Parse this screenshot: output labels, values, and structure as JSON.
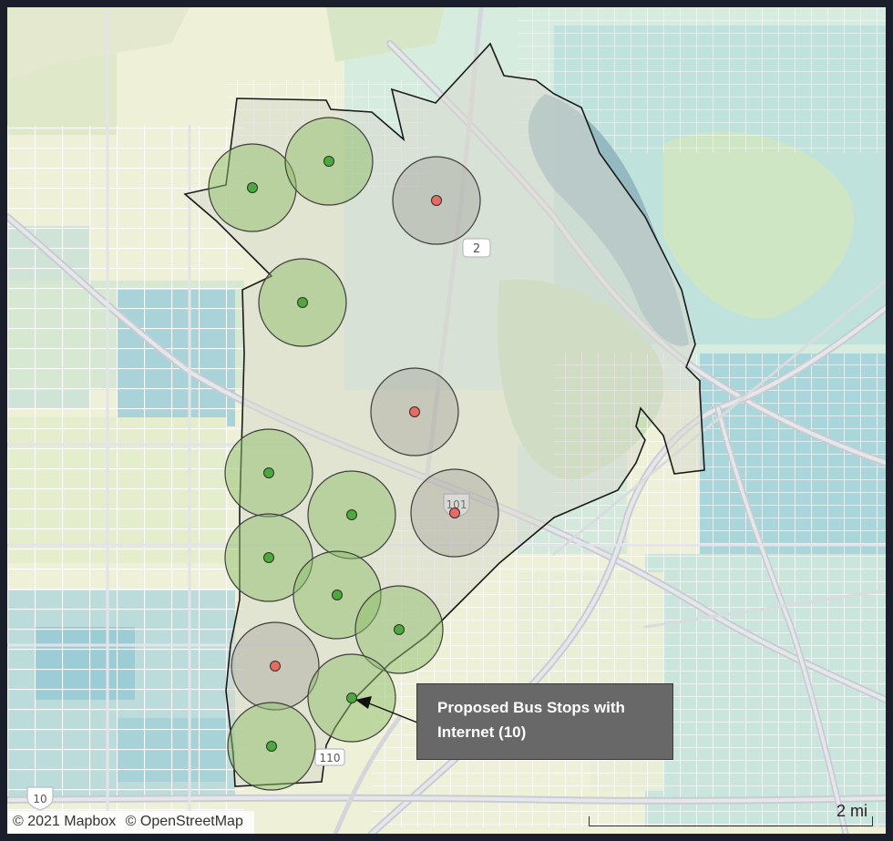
{
  "callout": {
    "text": "Proposed Bus Stops with Internet (10)"
  },
  "attribution": {
    "mapbox": "© 2021 Mapbox",
    "osm": "© OpenStreetMap"
  },
  "scale": {
    "label": "2 mi"
  },
  "road_shields": {
    "route_2": "2",
    "route_101": "101",
    "route_110": "110",
    "route_10": "10"
  },
  "stops": [
    {
      "id": 1,
      "status": "proposed-with-internet"
    },
    {
      "id": 2,
      "status": "proposed-with-internet"
    },
    {
      "id": 3,
      "status": "other"
    },
    {
      "id": 4,
      "status": "proposed-with-internet"
    },
    {
      "id": 5,
      "status": "other"
    },
    {
      "id": 6,
      "status": "proposed-with-internet"
    },
    {
      "id": 7,
      "status": "proposed-with-internet"
    },
    {
      "id": 8,
      "status": "other"
    },
    {
      "id": 9,
      "status": "proposed-with-internet"
    },
    {
      "id": 10,
      "status": "proposed-with-internet"
    },
    {
      "id": 11,
      "status": "proposed-with-internet"
    },
    {
      "id": 12,
      "status": "other"
    },
    {
      "id": 13,
      "status": "proposed-with-internet"
    },
    {
      "id": 14,
      "status": "proposed-with-internet"
    }
  ],
  "colors": {
    "green_dot": "#4caa3c",
    "red_dot": "#e86a63",
    "green_buffer": "#8dbd6a",
    "grey_buffer": "#9c9c94",
    "district_fill": "#dcdcd2",
    "water": "#7aaab8",
    "park": "#b6d3a8",
    "callout_bg": "#686868"
  }
}
